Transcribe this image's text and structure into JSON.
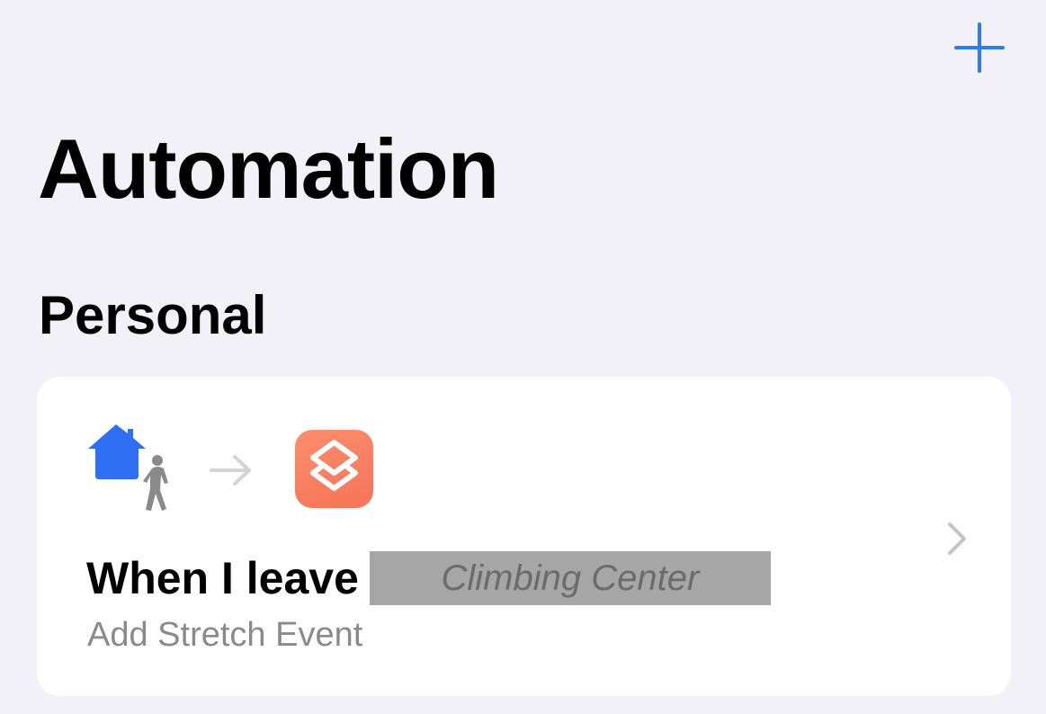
{
  "header": {
    "add_icon": "plus-icon",
    "accent_color": "#2f7bf5"
  },
  "page": {
    "title": "Automation"
  },
  "sections": [
    {
      "title": "Personal",
      "automations": [
        {
          "trigger_icon": "home-leave-icon",
          "arrow_icon": "arrow-right-icon",
          "app_icon": "shortcuts-app-icon",
          "trigger_label": "When I leave",
          "location": "Climbing Center",
          "action_label": "Add Stretch Event",
          "chevron_icon": "chevron-right-icon"
        }
      ]
    }
  ]
}
